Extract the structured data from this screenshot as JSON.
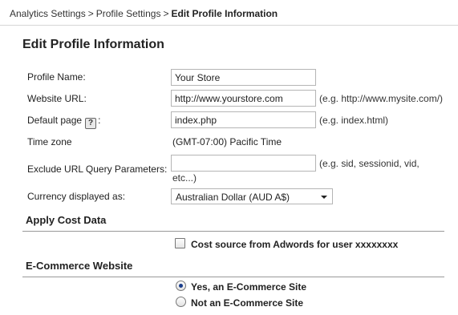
{
  "breadcrumb": {
    "items": [
      "Analytics Settings",
      "Profile Settings",
      "Edit Profile Information"
    ],
    "separator": ">"
  },
  "title": "Edit Profile Information",
  "form": {
    "profile_name": {
      "label": "Profile Name:",
      "value": "Your Store"
    },
    "website_url": {
      "label": "Website URL:",
      "value": "http://www.yourstore.com",
      "hint": "(e.g. http://www.mysite.com/)"
    },
    "default_page": {
      "label": "Default page",
      "help_icon": "?",
      "colon": ":",
      "value": "index.php",
      "hint": "(e.g. index.html)"
    },
    "time_zone": {
      "label": "Time zone",
      "value": "(GMT-07:00) Pacific Time"
    },
    "exclude_params": {
      "label": "Exclude URL Query Parameters:",
      "value": "",
      "hint_line1": "(e.g. sid, sessionid, vid,",
      "hint_line2": "etc...)"
    },
    "currency": {
      "label": "Currency displayed as:",
      "selected": "Australian Dollar (AUD A$)"
    }
  },
  "cost_data": {
    "title": "Apply Cost Data",
    "checkbox_label": "Cost source from Adwords for user xxxxxxxx",
    "checked": false
  },
  "ecommerce": {
    "title": "E-Commerce Website",
    "options": [
      {
        "label": "Yes, an E-Commerce Site",
        "selected": true
      },
      {
        "label": "Not an E-Commerce Site",
        "selected": false
      }
    ]
  },
  "colors": {
    "border": "#b5b5b5",
    "rule": "#999999",
    "radio_dot": "#1a3e8c"
  }
}
